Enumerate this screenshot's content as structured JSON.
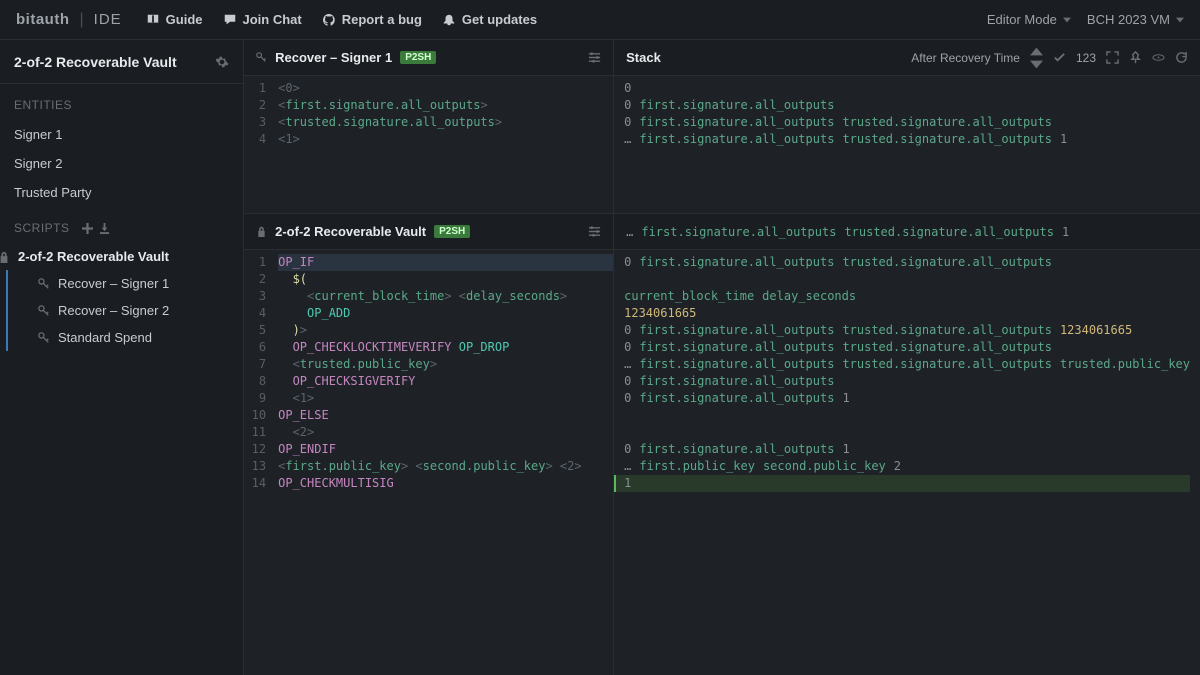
{
  "header": {
    "logo": "bitauth",
    "ide_label": "IDE",
    "links": [
      {
        "icon": "book",
        "label": "Guide"
      },
      {
        "icon": "chat",
        "label": "Join Chat"
      },
      {
        "icon": "github",
        "label": "Report a bug"
      },
      {
        "icon": "bell",
        "label": "Get updates"
      }
    ],
    "editor_mode_label": "Editor Mode",
    "vm_label": "BCH 2023 VM"
  },
  "sidebar": {
    "project_title": "2-of-2 Recoverable Vault",
    "entities_label": "ENTITIES",
    "entities": [
      "Signer 1",
      "Signer 2",
      "Trusted Party"
    ],
    "scripts_label": "SCRIPTS",
    "scripts": {
      "parent": "2-of-2 Recoverable Vault",
      "children": [
        "Recover – Signer 1",
        "Recover – Signer 2",
        "Standard Spend"
      ]
    }
  },
  "top_pane": {
    "title": "Recover – Signer 1",
    "badge": "P2SH",
    "lines": [
      [
        {
          "t": "angle",
          "v": "<"
        },
        {
          "t": "num",
          "v": "0"
        },
        {
          "t": "angle",
          "v": ">"
        }
      ],
      [
        {
          "t": "angle",
          "v": "<"
        },
        {
          "t": "var",
          "v": "first.signature.all_outputs"
        },
        {
          "t": "angle",
          "v": ">"
        }
      ],
      [
        {
          "t": "angle",
          "v": "<"
        },
        {
          "t": "var",
          "v": "trusted.signature.all_outputs"
        },
        {
          "t": "angle",
          "v": ">"
        }
      ],
      [
        {
          "t": "angle",
          "v": "<"
        },
        {
          "t": "num",
          "v": "1"
        },
        {
          "t": "angle",
          "v": ">"
        }
      ]
    ],
    "stack_header": {
      "label": "Stack",
      "scenario": "After Recovery Time",
      "count": "123"
    },
    "stack_rows": [
      [
        {
          "t": "num",
          "v": "0"
        }
      ],
      [
        {
          "t": "num",
          "v": "0"
        },
        {
          "t": "var",
          "v": "first.signature.all_outputs"
        }
      ],
      [
        {
          "t": "num",
          "v": "0"
        },
        {
          "t": "var",
          "v": "first.signature.all_outputs"
        },
        {
          "t": "var",
          "v": "trusted.signature.all_outputs"
        }
      ],
      [
        {
          "t": "ell",
          "v": "…"
        },
        {
          "t": "var",
          "v": "first.signature.all_outputs"
        },
        {
          "t": "var",
          "v": "trusted.signature.all_outputs"
        },
        {
          "t": "num",
          "v": "1"
        }
      ]
    ]
  },
  "bottom_pane": {
    "title": "2-of-2 Recoverable Vault",
    "badge": "P2SH",
    "summary_row": [
      {
        "t": "ell",
        "v": "…"
      },
      {
        "t": "var",
        "v": "first.signature.all_outputs"
      },
      {
        "t": "var",
        "v": "trusted.signature.all_outputs"
      },
      {
        "t": "num",
        "v": "1"
      }
    ],
    "lines": [
      {
        "indent": 0,
        "tokens": [
          {
            "t": "op",
            "v": "OP_IF"
          }
        ],
        "hl": true
      },
      {
        "indent": 1,
        "tokens": [
          {
            "t": "yellow",
            "v": "$("
          }
        ]
      },
      {
        "indent": 2,
        "tokens": [
          {
            "t": "angle",
            "v": "<"
          },
          {
            "t": "var",
            "v": "current_block_time"
          },
          {
            "t": "angle",
            "v": "> "
          },
          {
            "t": "angle",
            "v": "<"
          },
          {
            "t": "var",
            "v": "delay_seconds"
          },
          {
            "t": "angle",
            "v": ">"
          }
        ]
      },
      {
        "indent": 2,
        "tokens": [
          {
            "t": "op2",
            "v": "OP_ADD"
          }
        ]
      },
      {
        "indent": 1,
        "tokens": [
          {
            "t": "yellow",
            "v": ")"
          },
          {
            "t": "angle",
            "v": ">"
          }
        ]
      },
      {
        "indent": 1,
        "tokens": [
          {
            "t": "op",
            "v": "OP_CHECKLOCKTIMEVERIFY "
          },
          {
            "t": "op2",
            "v": "OP_DROP"
          }
        ]
      },
      {
        "indent": 1,
        "tokens": [
          {
            "t": "angle",
            "v": "<"
          },
          {
            "t": "var",
            "v": "trusted.public_key"
          },
          {
            "t": "angle",
            "v": ">"
          }
        ]
      },
      {
        "indent": 1,
        "tokens": [
          {
            "t": "op",
            "v": "OP_CHECKSIGVERIFY"
          }
        ]
      },
      {
        "indent": 1,
        "tokens": [
          {
            "t": "angle",
            "v": "<"
          },
          {
            "t": "num",
            "v": "1"
          },
          {
            "t": "angle",
            "v": ">"
          }
        ]
      },
      {
        "indent": 0,
        "tokens": [
          {
            "t": "op",
            "v": "OP_ELSE"
          }
        ]
      },
      {
        "indent": 1,
        "tokens": [
          {
            "t": "num",
            "v": "<2>"
          }
        ]
      },
      {
        "indent": 0,
        "tokens": [
          {
            "t": "op",
            "v": "OP_ENDIF"
          }
        ]
      },
      {
        "indent": 0,
        "tokens": [
          {
            "t": "angle",
            "v": "<"
          },
          {
            "t": "var",
            "v": "first.public_key"
          },
          {
            "t": "angle",
            "v": "> "
          },
          {
            "t": "angle",
            "v": "<"
          },
          {
            "t": "var",
            "v": "second.public_key"
          },
          {
            "t": "angle",
            "v": "> "
          },
          {
            "t": "angle",
            "v": "<"
          },
          {
            "t": "num",
            "v": "2"
          },
          {
            "t": "angle",
            "v": ">"
          }
        ]
      },
      {
        "indent": 0,
        "tokens": [
          {
            "t": "op",
            "v": "OP_CHECKMULTISIG"
          }
        ]
      }
    ],
    "stack_rows": [
      {
        "tokens": [
          {
            "t": "num",
            "v": "0"
          },
          {
            "t": "var",
            "v": "first.signature.all_outputs"
          },
          {
            "t": "var",
            "v": "trusted.signature.all_outputs"
          }
        ]
      },
      {
        "blank": true
      },
      {
        "tokens": [
          {
            "t": "var",
            "v": "current_block_time"
          },
          {
            "t": "var",
            "v": "delay_seconds"
          }
        ]
      },
      {
        "tokens": [
          {
            "t": "lit",
            "v": "1234061665"
          }
        ]
      },
      {
        "tokens": [
          {
            "t": "num",
            "v": "0"
          },
          {
            "t": "var",
            "v": "first.signature.all_outputs"
          },
          {
            "t": "var",
            "v": "trusted.signature.all_outputs"
          },
          {
            "t": "lit",
            "v": "1234061665"
          }
        ]
      },
      {
        "tokens": [
          {
            "t": "num",
            "v": "0"
          },
          {
            "t": "var",
            "v": "first.signature.all_outputs"
          },
          {
            "t": "var",
            "v": "trusted.signature.all_outputs"
          }
        ]
      },
      {
        "tokens": [
          {
            "t": "ell",
            "v": "…"
          },
          {
            "t": "var",
            "v": "first.signature.all_outputs"
          },
          {
            "t": "var",
            "v": "trusted.signature.all_outputs"
          },
          {
            "t": "var",
            "v": "trusted.public_key"
          }
        ]
      },
      {
        "tokens": [
          {
            "t": "num",
            "v": "0"
          },
          {
            "t": "var",
            "v": "first.signature.all_outputs"
          }
        ]
      },
      {
        "tokens": [
          {
            "t": "num",
            "v": "0"
          },
          {
            "t": "var",
            "v": "first.signature.all_outputs"
          },
          {
            "t": "num",
            "v": "1"
          }
        ]
      },
      {
        "blank": true
      },
      {
        "blank": true
      },
      {
        "tokens": [
          {
            "t": "num",
            "v": "0"
          },
          {
            "t": "var",
            "v": "first.signature.all_outputs"
          },
          {
            "t": "num",
            "v": "1"
          }
        ]
      },
      {
        "tokens": [
          {
            "t": "ell",
            "v": "…"
          },
          {
            "t": "var",
            "v": "first.public_key"
          },
          {
            "t": "var",
            "v": "second.public_key"
          },
          {
            "t": "num",
            "v": "2"
          }
        ]
      },
      {
        "tokens": [
          {
            "t": "num",
            "v": "1"
          }
        ],
        "hl": true
      }
    ]
  }
}
